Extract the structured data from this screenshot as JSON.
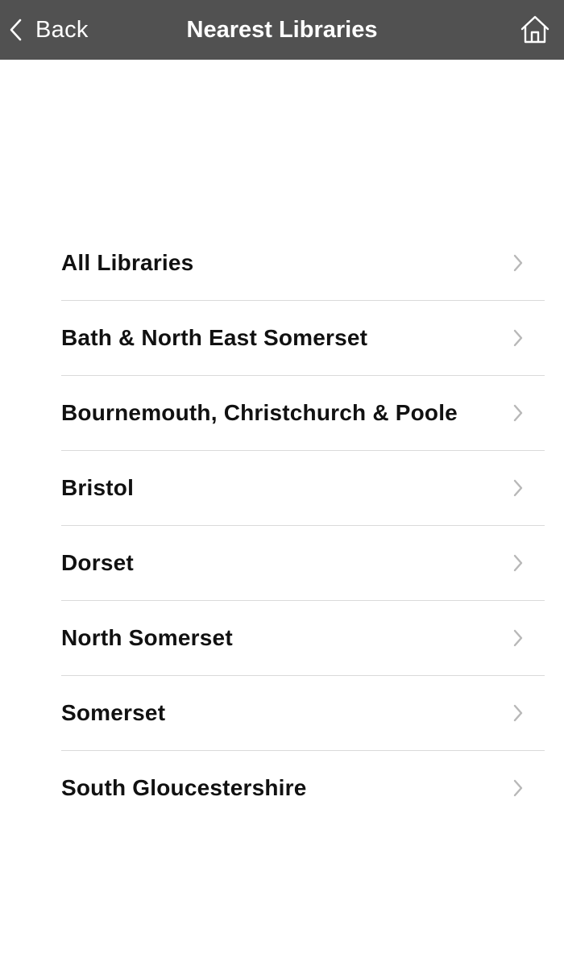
{
  "navbar": {
    "back_label": "Back",
    "title": "Nearest Libraries",
    "home_icon": "home-icon",
    "background_color": "#515151"
  },
  "libraries": {
    "items": [
      {
        "label": "All Libraries"
      },
      {
        "label": "Bath & North East Somerset"
      },
      {
        "label": "Bournemouth, Christchurch & Poole"
      },
      {
        "label": "Bristol"
      },
      {
        "label": "Dorset"
      },
      {
        "label": "North Somerset"
      },
      {
        "label": "Somerset"
      },
      {
        "label": "South Gloucestershire"
      }
    ],
    "chevron_icon": "chevron-right-icon",
    "chevron_color": "#b8b8b8",
    "divider_color": "#dadada"
  }
}
